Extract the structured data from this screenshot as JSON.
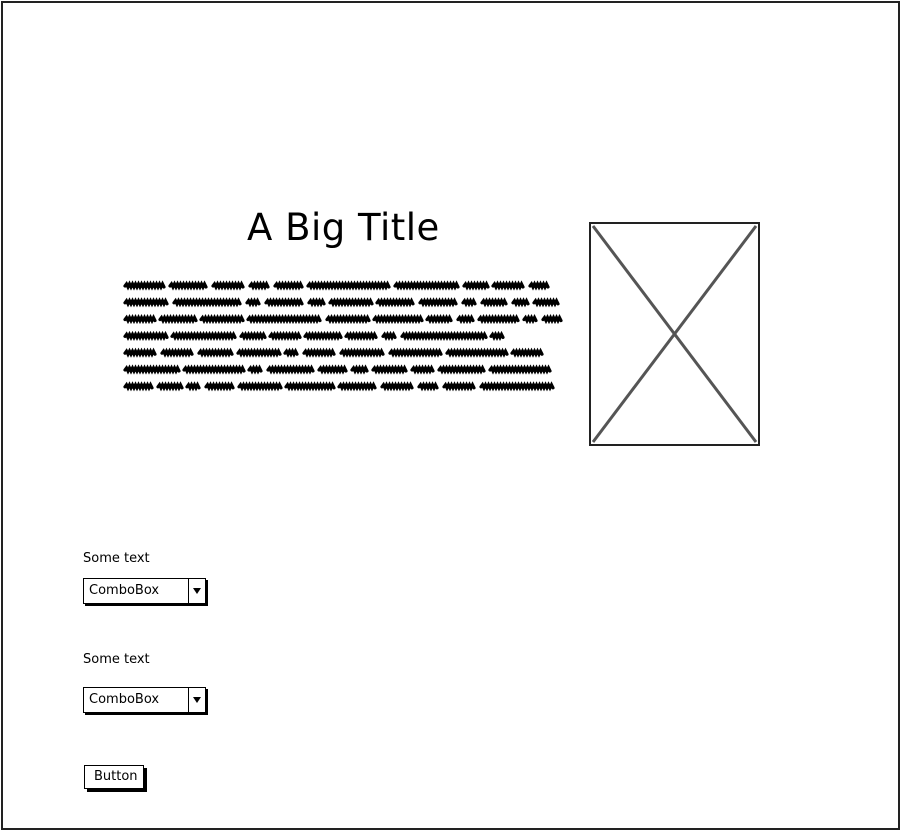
{
  "title": "A Big Title",
  "image_placeholder": {
    "icon": "image-placeholder-x"
  },
  "fields": [
    {
      "label": "Some text",
      "combobox_value": "ComboBox"
    },
    {
      "label": "Some text",
      "combobox_value": "ComboBox"
    }
  ],
  "button": {
    "label": "Button"
  },
  "colors": {
    "ink": "#000000",
    "placeholder_stroke": "#555555",
    "background": "#ffffff"
  }
}
